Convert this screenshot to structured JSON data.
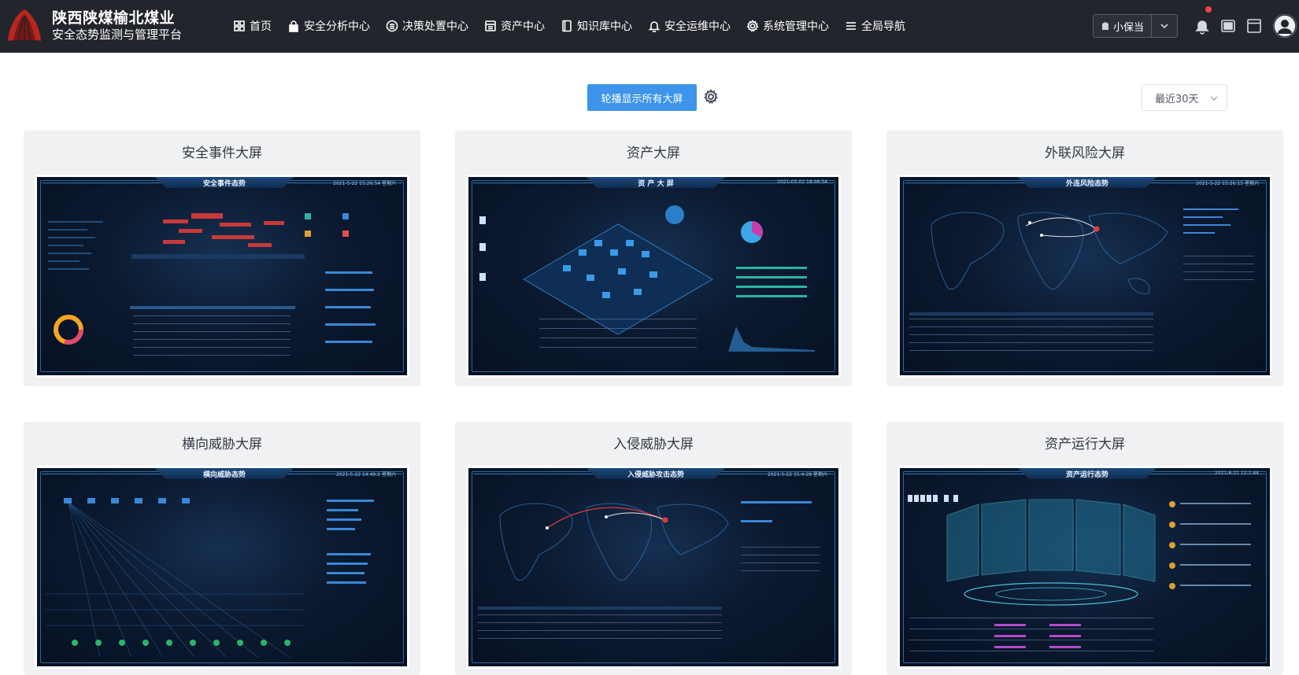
{
  "header": {
    "brand_title": "陕西陕煤榆北煤业",
    "brand_subtitle": "安全态势监测与管理平台",
    "nav": [
      {
        "label": "首页",
        "icon": "grid-icon"
      },
      {
        "label": "安全分析中心",
        "icon": "lock-icon"
      },
      {
        "label": "决策处置中心",
        "icon": "list-circle-icon"
      },
      {
        "label": "资产中心",
        "icon": "server-icon"
      },
      {
        "label": "知识库中心",
        "icon": "book-icon"
      },
      {
        "label": "安全运维中心",
        "icon": "bell-icon"
      },
      {
        "label": "系统管理中心",
        "icon": "gear-icon"
      },
      {
        "label": "全局导航",
        "icon": "menu-icon"
      }
    ],
    "user_select_value": "小保当"
  },
  "toolbar": {
    "carousel_label": "轮播显示所有大屏",
    "range_value": "最近30天"
  },
  "cards": [
    {
      "title": "安全事件大屏",
      "screen_title": "安全事件态势",
      "screen_date": "2021-5-22 15:26:54 星期六"
    },
    {
      "title": "资产大屏",
      "screen_title": "资 产 大 屏",
      "screen_date": "2021-05-02 18:06:54"
    },
    {
      "title": "外联风险大屏",
      "screen_title": "外连风险态势",
      "screen_date": "2021-5-22 15:26:15 星期六"
    },
    {
      "title": "横向威胁大屏",
      "screen_title": "横向威胁态势",
      "screen_date": "2021-5-22 14:49:2 星期六"
    },
    {
      "title": "入侵威胁大屏",
      "screen_title": "入侵威胁攻击态势",
      "screen_date": "2021-5-22 15:4:28 星期六"
    },
    {
      "title": "资产运行大屏",
      "screen_title": "资产运行态势",
      "screen_date": "2021-6-21 12:2:44"
    }
  ],
  "colors": {
    "topbar": "#23252c",
    "primary": "#3d94ea",
    "card_bg": "#f0f1f3",
    "screen_bg": "#0b1a30",
    "screen_accent": "#2f7bbd"
  }
}
